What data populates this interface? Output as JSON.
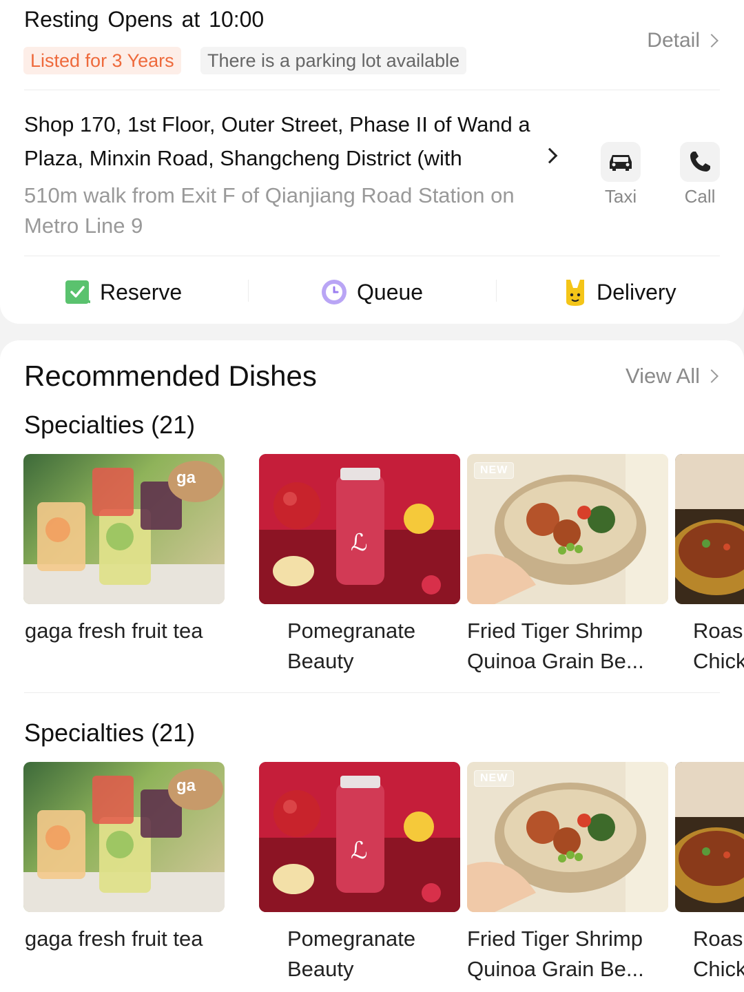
{
  "header": {
    "status": "Resting",
    "opens": "Opens at 10:00",
    "tags": [
      "Listed for 3 Years",
      "There is a parking lot available"
    ],
    "detail_label": "Detail"
  },
  "address": {
    "text": "Shop 170, 1st Floor, Outer Street, Phase II of Wand a Plaza, Minxin Road, Shangcheng District (with",
    "walk": "510m walk from Exit F of Qianjiang Road Station on Metro Line 9"
  },
  "actions": [
    {
      "label": "Taxi",
      "icon": "car-icon"
    },
    {
      "label": "Call",
      "icon": "phone-icon"
    }
  ],
  "services": [
    {
      "label": "Reserve",
      "icon": "reserve-icon",
      "color": "#5ac26e"
    },
    {
      "label": "Queue",
      "icon": "queue-icon",
      "color": "#9b7ef0"
    },
    {
      "label": "Delivery",
      "icon": "delivery-icon",
      "color": "#f4c518"
    }
  ],
  "dishes_section": {
    "title": "Recommended Dishes",
    "view_all": "View All",
    "groups": [
      {
        "title": "Specialties (21)",
        "items": [
          {
            "name": "gaga fresh fruit tea",
            "watermark": "ga"
          },
          {
            "name": "Pomegranate Beauty"
          },
          {
            "name": "Fried Tiger Shrimp Quinoa Grain Be...",
            "badge": "NEW"
          },
          {
            "name": "Roas Chick"
          }
        ]
      },
      {
        "title": "Specialties (21)",
        "items": [
          {
            "name": "gaga fresh fruit tea",
            "watermark": "ga"
          },
          {
            "name": "Pomegranate Beauty"
          },
          {
            "name": "Fried Tiger Shrimp Quinoa Grain Be...",
            "badge": "NEW"
          },
          {
            "name": "Roas Chick"
          }
        ]
      }
    ]
  }
}
